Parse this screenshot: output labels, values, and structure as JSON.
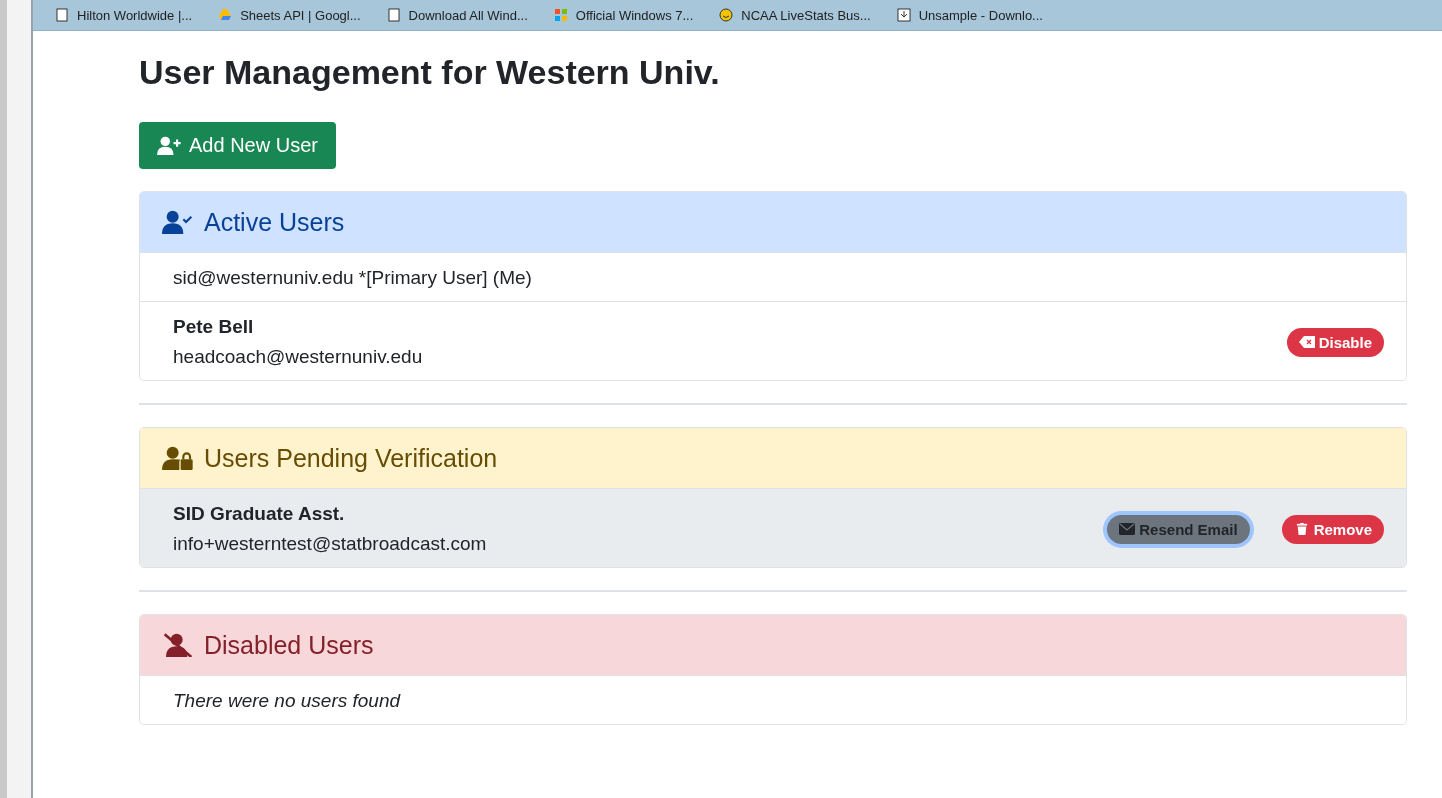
{
  "bookmarks": [
    {
      "label": "Hilton Worldwide |...",
      "kind": "page"
    },
    {
      "label": "Sheets API | Googl...",
      "kind": "sheets"
    },
    {
      "label": "Download All Wind...",
      "kind": "page"
    },
    {
      "label": "Official Windows 7...",
      "kind": "windows"
    },
    {
      "label": "NCAA LiveStats Bus...",
      "kind": "smiley"
    },
    {
      "label": "Unsample - Downlo...",
      "kind": "download"
    }
  ],
  "title": "User Management for Western Univ.",
  "add_button": {
    "label": "Add New User"
  },
  "sections": [
    {
      "kind": "active",
      "title": "Active Users",
      "users": [
        {
          "text": "sid@westernuniv.edu *[Primary User] (Me)",
          "highlighted": false
        },
        {
          "name": "Pete Bell",
          "email": "headcoach@westernuniv.edu",
          "highlighted": false,
          "actions": [
            {
              "label": "Disable",
              "kind": "disable",
              "focused": false
            }
          ]
        }
      ]
    },
    {
      "kind": "pending",
      "title": "Users Pending Verification",
      "users": [
        {
          "name": "SID Graduate Asst.",
          "email": "info+westerntest@statbroadcast.com",
          "highlighted": true,
          "actions": [
            {
              "label": "Resend Email",
              "kind": "resend",
              "focused": true
            },
            {
              "label": "Remove",
              "kind": "remove",
              "focused": false
            }
          ]
        }
      ]
    },
    {
      "kind": "disabled",
      "title": "Disabled Users",
      "empty_text": "There were no users found"
    }
  ]
}
